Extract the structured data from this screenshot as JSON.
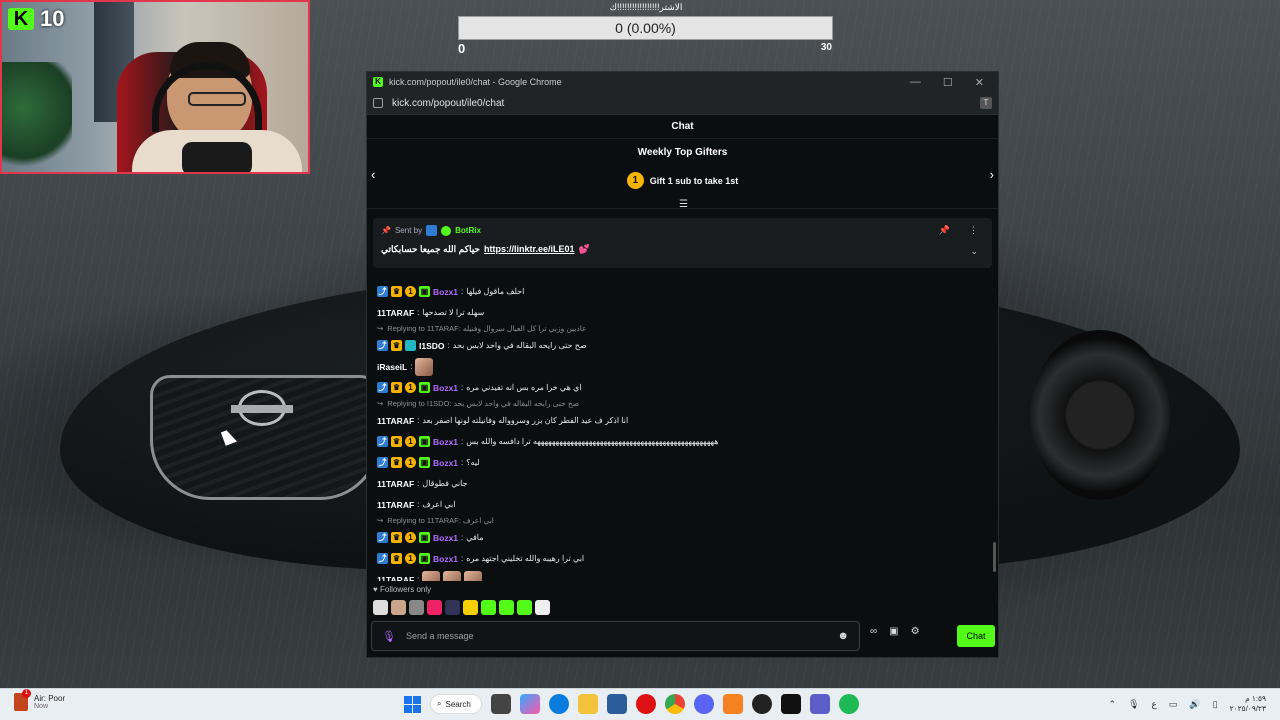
{
  "webcam": {
    "badge_letter": "K",
    "viewer_count": "10"
  },
  "goal": {
    "title": "الاشتر!!!!!!!!!!!!!!!!!ك",
    "value_text": "0 (0.00%)",
    "progress": 0,
    "min_label": "0",
    "max_label": "30"
  },
  "window": {
    "title": "kick.com/popout/ile0/chat - Google Chrome",
    "url": "kick.com/popout/ile0/chat",
    "controls": {
      "minimize": "—",
      "maximize": "☐",
      "close": "✕"
    }
  },
  "chat": {
    "header": "Chat",
    "gifters": {
      "title": "Weekly Top Gifters",
      "rank": "1",
      "cta": "Gift 1 sub to take 1st"
    },
    "pinned": {
      "sent_by_label": "Sent by",
      "sender": "BotRix",
      "text": "حياكم الله جميعا حسابكاتي",
      "link": "https://linktr.ee/iLE01"
    },
    "messages": [
      {
        "user": "Bozx1",
        "color": "#b36bff",
        "badges": [
          "mod",
          "crown",
          "sub",
          "gift"
        ],
        "text": "احلف ماقول فيلها"
      },
      {
        "user": "11TARAF",
        "color": "#ffffff",
        "badges": [],
        "text": "سهله ترا لا تصدحها"
      },
      {
        "reply": "Replying to 11TARAF: عاديين وزبي ترا كل العيال سروال وفنيله"
      },
      {
        "user": "I1SDO",
        "color": "#ffffff",
        "badges": [
          "mod",
          "crown",
          "vip"
        ],
        "text": "صح حتى رايحه البقاله في واحد لابس بحد"
      },
      {
        "user": "iRaseiL",
        "color": "#ffffff",
        "badges": [],
        "text": "",
        "emotes": 1
      },
      {
        "user": "Bozx1",
        "color": "#b36bff",
        "badges": [
          "mod",
          "crown",
          "sub",
          "gift"
        ],
        "text": "اي هي خرا مره بس انه تفيدني مره"
      },
      {
        "reply": "Replying to I1SDO: صح حتى رايحه البقاله في واحد لابس بحد"
      },
      {
        "user": "11TARAF",
        "color": "#ffffff",
        "badges": [],
        "text": "انا اذكر ف عيد الفطر كان بزر وسروواله وفانيلته لونها اصفر بعد"
      },
      {
        "user": "Bozx1",
        "color": "#b36bff",
        "badges": [
          "mod",
          "crown",
          "sub",
          "gift"
        ],
        "text": "هههههههههههههههههههههههههههههههههههههههههههههههههه ترا دافسه والله بس"
      },
      {
        "user": "Bozx1",
        "color": "#b36bff",
        "badges": [
          "mod",
          "crown",
          "sub",
          "gift"
        ],
        "text": "ليه؟"
      },
      {
        "user": "11TARAF",
        "color": "#ffffff",
        "badges": [],
        "text": "جاني فطوقال"
      },
      {
        "user": "11TARAF",
        "color": "#ffffff",
        "badges": [],
        "text": "ابي اعرف"
      },
      {
        "reply": "Replying to 11TARAF: ابي اعرف"
      },
      {
        "user": "Bozx1",
        "color": "#b36bff",
        "badges": [
          "mod",
          "crown",
          "sub",
          "gift"
        ],
        "text": "مافي"
      },
      {
        "user": "Bozx1",
        "color": "#b36bff",
        "badges": [
          "mod",
          "crown",
          "sub",
          "gift"
        ],
        "text": "ابي ترا رهيبه والله تخليني اجتهد مره"
      },
      {
        "user": "11TARAF",
        "color": "#ffffff",
        "badges": [],
        "text": "",
        "emotes": 3
      }
    ],
    "followers_only": "Followers only",
    "input_placeholder": "Send a message",
    "send_label": "Chat"
  },
  "taskbar": {
    "weather_title": "Air: Poor",
    "weather_sub": "Now",
    "weather_badge": "1",
    "search_label": "Search",
    "lang": "ع",
    "time": "١:٥٩ م",
    "date": "٢٠٢٥/٠٩/٢٣"
  },
  "colors": {
    "kick_green": "#53fc18",
    "mod_blue": "#2f7cd3",
    "sub_gold": "#f5b400",
    "user_purple": "#b36bff"
  }
}
